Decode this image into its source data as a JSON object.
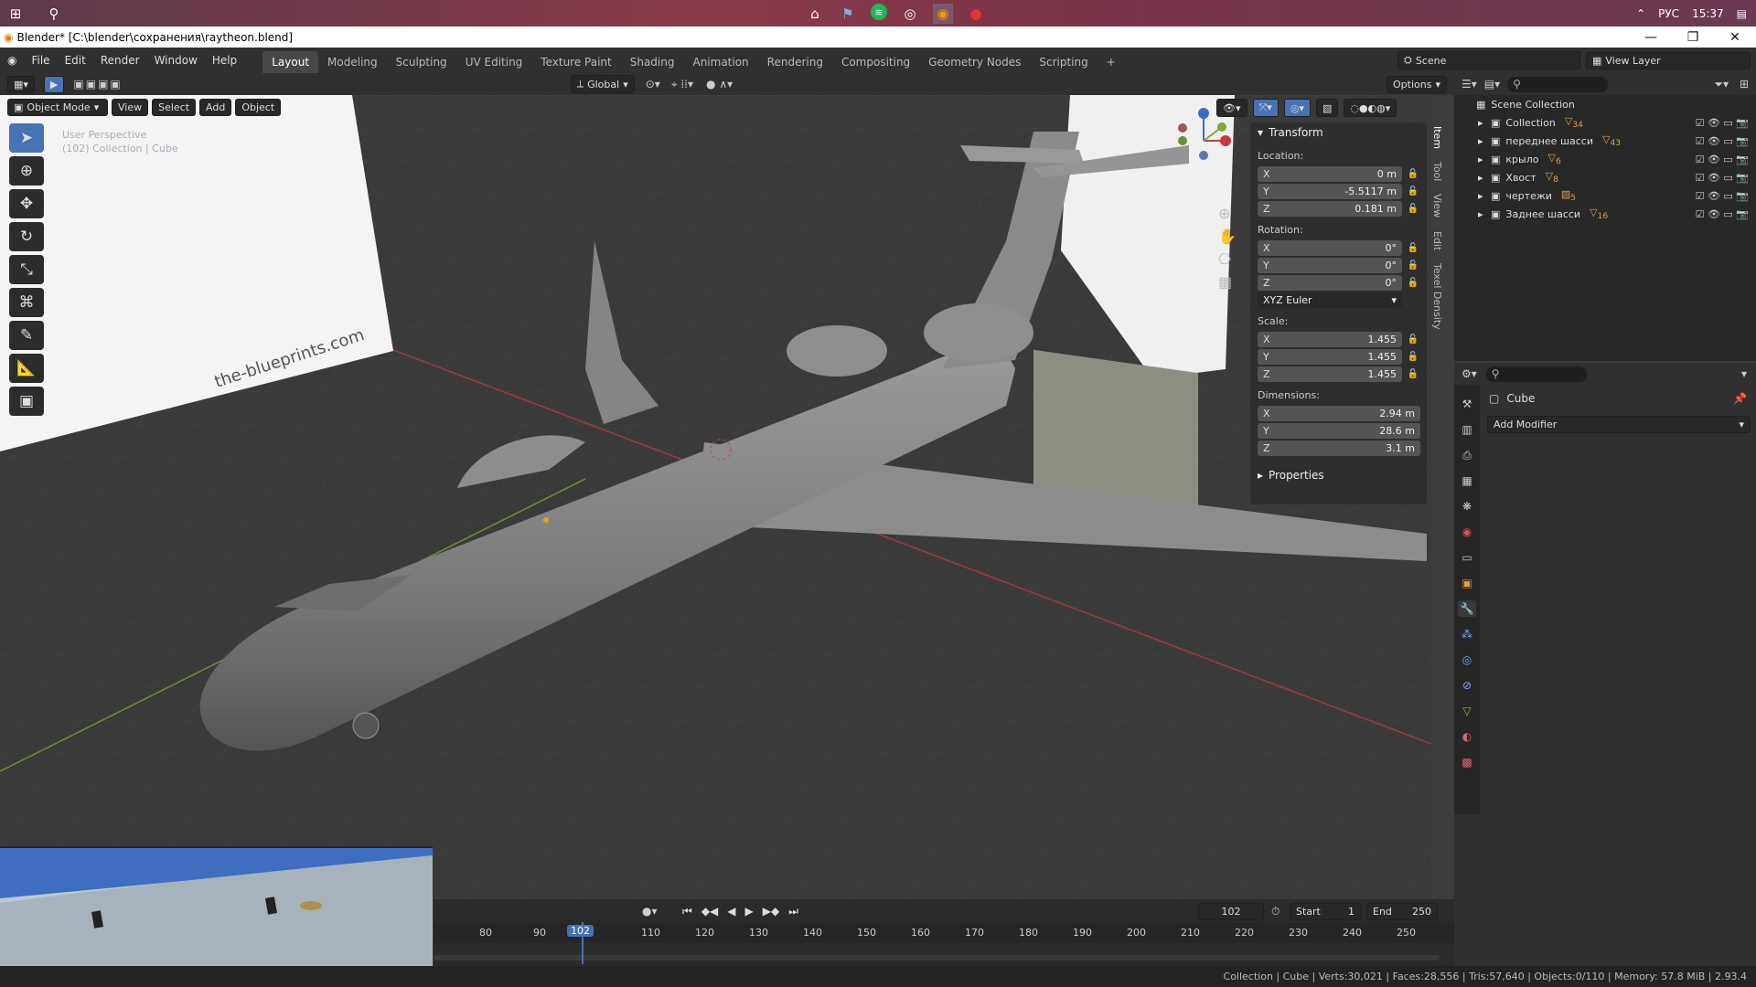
{
  "taskbar": {
    "tray_lang": "РУС",
    "tray_time": "15:37"
  },
  "window": {
    "title": "Blender* [C:\\blender\\сохранения\\raytheon.blend]"
  },
  "menu": {
    "items": [
      "File",
      "Edit",
      "Render",
      "Window",
      "Help"
    ]
  },
  "workspaces": {
    "tabs": [
      "Layout",
      "Modeling",
      "Sculpting",
      "UV Editing",
      "Texture Paint",
      "Shading",
      "Animation",
      "Rendering",
      "Compositing",
      "Geometry Nodes",
      "Scripting"
    ],
    "active": "Layout",
    "add": "+"
  },
  "scene": {
    "scene_name": "Scene",
    "view_layer": "View Layer"
  },
  "viewport_header": {
    "orientation": "Global",
    "options": "Options"
  },
  "viewport": {
    "mode": "Object Mode",
    "menus": [
      "View",
      "Select",
      "Add",
      "Object"
    ],
    "overlay_text_1": "User Perspective",
    "overlay_text_2": "(102) Collection | Cube",
    "watermark": "the-blueprints.com"
  },
  "transform": {
    "panel_title": "Transform",
    "location_label": "Location:",
    "location": [
      {
        "axis": "X",
        "value": "0 m"
      },
      {
        "axis": "Y",
        "value": "-5.5117 m"
      },
      {
        "axis": "Z",
        "value": "0.181 m"
      }
    ],
    "rotation_label": "Rotation:",
    "rotation": [
      {
        "axis": "X",
        "value": "0°"
      },
      {
        "axis": "Y",
        "value": "0°"
      },
      {
        "axis": "Z",
        "value": "0°"
      }
    ],
    "rotation_mode": "XYZ Euler",
    "scale_label": "Scale:",
    "scale": [
      {
        "axis": "X",
        "value": "1.455"
      },
      {
        "axis": "Y",
        "value": "1.455"
      },
      {
        "axis": "Z",
        "value": "1.455"
      }
    ],
    "dimensions_label": "Dimensions:",
    "dimensions": [
      {
        "axis": "X",
        "value": "2.94 m"
      },
      {
        "axis": "Y",
        "value": "28.6 m"
      },
      {
        "axis": "Z",
        "value": "3.1 m"
      }
    ],
    "properties_title": "Properties"
  },
  "side_tabs": [
    "Item",
    "Tool",
    "View",
    "Edit",
    "Texel Density"
  ],
  "outliner": {
    "root": "Scene Collection",
    "items": [
      {
        "name": "Collection",
        "count": "34"
      },
      {
        "name": "переднее шасси",
        "count": "43"
      },
      {
        "name": "крыло",
        "count": "6"
      },
      {
        "name": "Хвост",
        "count": "8"
      },
      {
        "name": "чертежи",
        "count": "5"
      },
      {
        "name": "Заднее шасси",
        "count": "16"
      }
    ]
  },
  "properties": {
    "object_name": "Cube",
    "add_modifier": "Add Modifier"
  },
  "timeline": {
    "current_frame": "102",
    "start_label": "Start",
    "start": "1",
    "end_label": "End",
    "end": "250",
    "ticks": [
      "80",
      "90",
      "1",
      "110",
      "120",
      "130",
      "140",
      "150",
      "160",
      "170",
      "180",
      "190",
      "200",
      "210",
      "220",
      "230",
      "240",
      "250"
    ]
  },
  "statusbar": {
    "text": "Collection | Cube | Verts:30,021 | Faces:28,556 | Tris:57,640 | Objects:0/110 | Memory: 57.8 MiB | 2.93.4"
  },
  "colors": {
    "accent": "#4772b3",
    "x_axis": "#c43b3b",
    "y_axis": "#7fa83a",
    "z_axis": "#3b6dc4"
  }
}
